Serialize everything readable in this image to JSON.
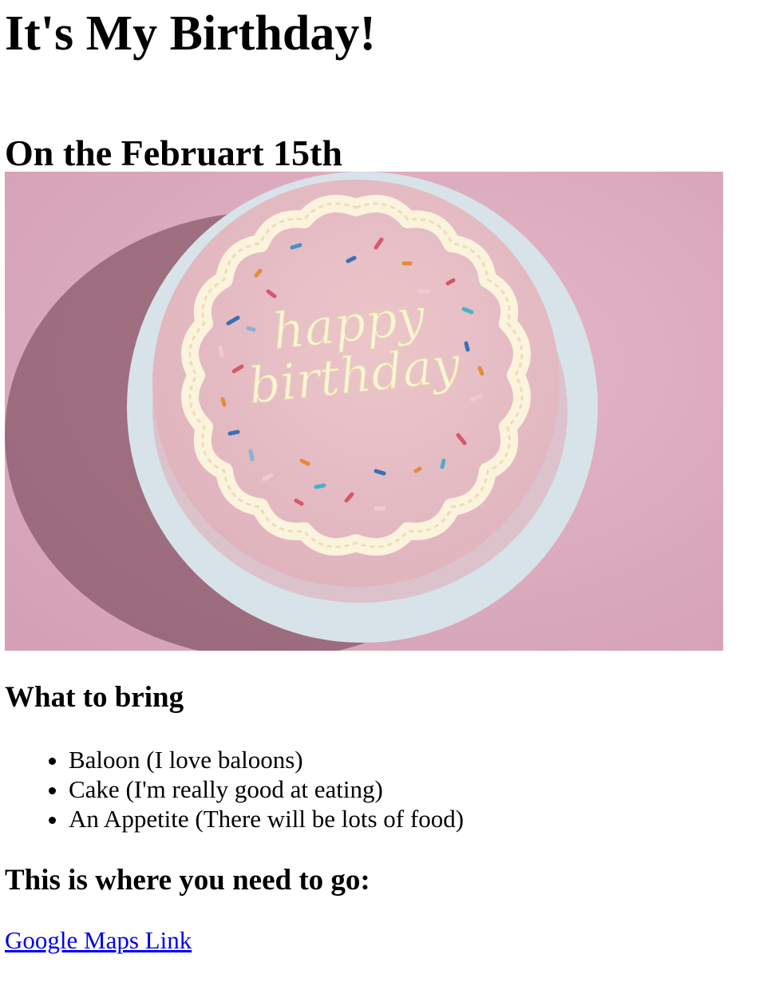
{
  "page": {
    "title": "It's My Birthday!",
    "subtitle": "On the Februart 15th"
  },
  "hero_image": {
    "icon": "birthday-cake-photo",
    "cake_lettering": "happy birthday",
    "colors": {
      "background": "#dca8bd",
      "cake_top": "#e7bcc3",
      "board": "#d6e4ea",
      "frosting": "#fbf3dc"
    }
  },
  "bring": {
    "heading": "What to bring",
    "items": [
      "Baloon (I love baloons)",
      "Cake (I'm really good at eating)",
      "An Appetite (There will be lots of food)"
    ]
  },
  "location": {
    "heading": "This is where you need to go:",
    "link_text": "Google Maps Link",
    "link_color": "#0000ee"
  }
}
